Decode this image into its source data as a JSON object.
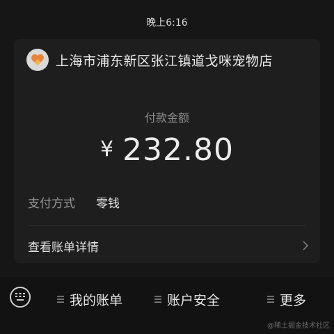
{
  "status_bar": {
    "time": "晚上6:16"
  },
  "merchant": {
    "name": "上海市浦东新区张江镇道戈咪宠物店",
    "logo_icon": "merchant-logo-icon"
  },
  "payment": {
    "amount_label": "付款金额",
    "currency_symbol": "¥",
    "amount": "232.80",
    "method_label": "支付方式",
    "method_value": "零钱"
  },
  "bill_link": {
    "label": "查看账单详情",
    "icon": "chevron-right-icon"
  },
  "bottom_menu": {
    "keyboard_icon": "keyboard-icon",
    "items": [
      {
        "label": "我的账单",
        "icon": "menu-lines-icon"
      },
      {
        "label": "账户安全",
        "icon": "menu-lines-icon"
      },
      {
        "label": "更多",
        "icon": "menu-lines-icon"
      }
    ]
  },
  "watermark": "@稀土掘金技术社区"
}
